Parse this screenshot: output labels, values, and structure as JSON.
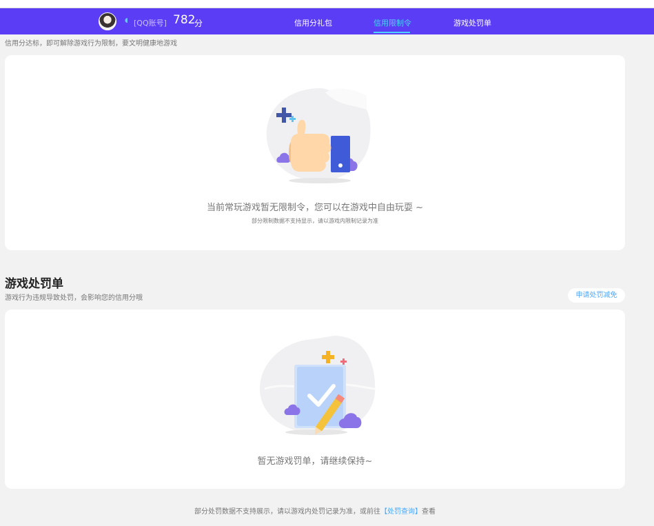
{
  "header": {
    "account_label": "[QQ账号]",
    "score": "782",
    "score_unit": "分",
    "tabs": [
      {
        "label": "信用分礼包",
        "active": false
      },
      {
        "label": "信用限制令",
        "active": true
      },
      {
        "label": "游戏处罚单",
        "active": false
      }
    ]
  },
  "restriction": {
    "hint": "信用分达标，即可解除游戏行为限制，要文明健康地游戏",
    "empty_message": "当前常玩游戏暂无限制令，您可以在游戏中自由玩耍 ~",
    "empty_sub": "部分限制数据不支持显示，请以游戏内限制记录为准"
  },
  "penalty": {
    "title": "游戏处罚单",
    "description": "游戏行为违规导致处罚，会影响您的信用分哦",
    "apply_button": "申请处罚减免",
    "empty_message": "暂无游戏罚单，请继续保持~"
  },
  "footer": {
    "text_before": "部分处罚数据不支持展示，请以游戏内处罚记录为准，或前往",
    "link": "【处罚查询】",
    "text_after": "查看"
  },
  "colors": {
    "navbar": "#5b3df6",
    "accent": "#4fd1ff",
    "link": "#4aa8ff",
    "background": "#f2f2f2"
  },
  "icons": {
    "qq": "qq-icon",
    "thumbs_up": "thumbs-up-illustration",
    "document_check": "document-check-illustration"
  }
}
